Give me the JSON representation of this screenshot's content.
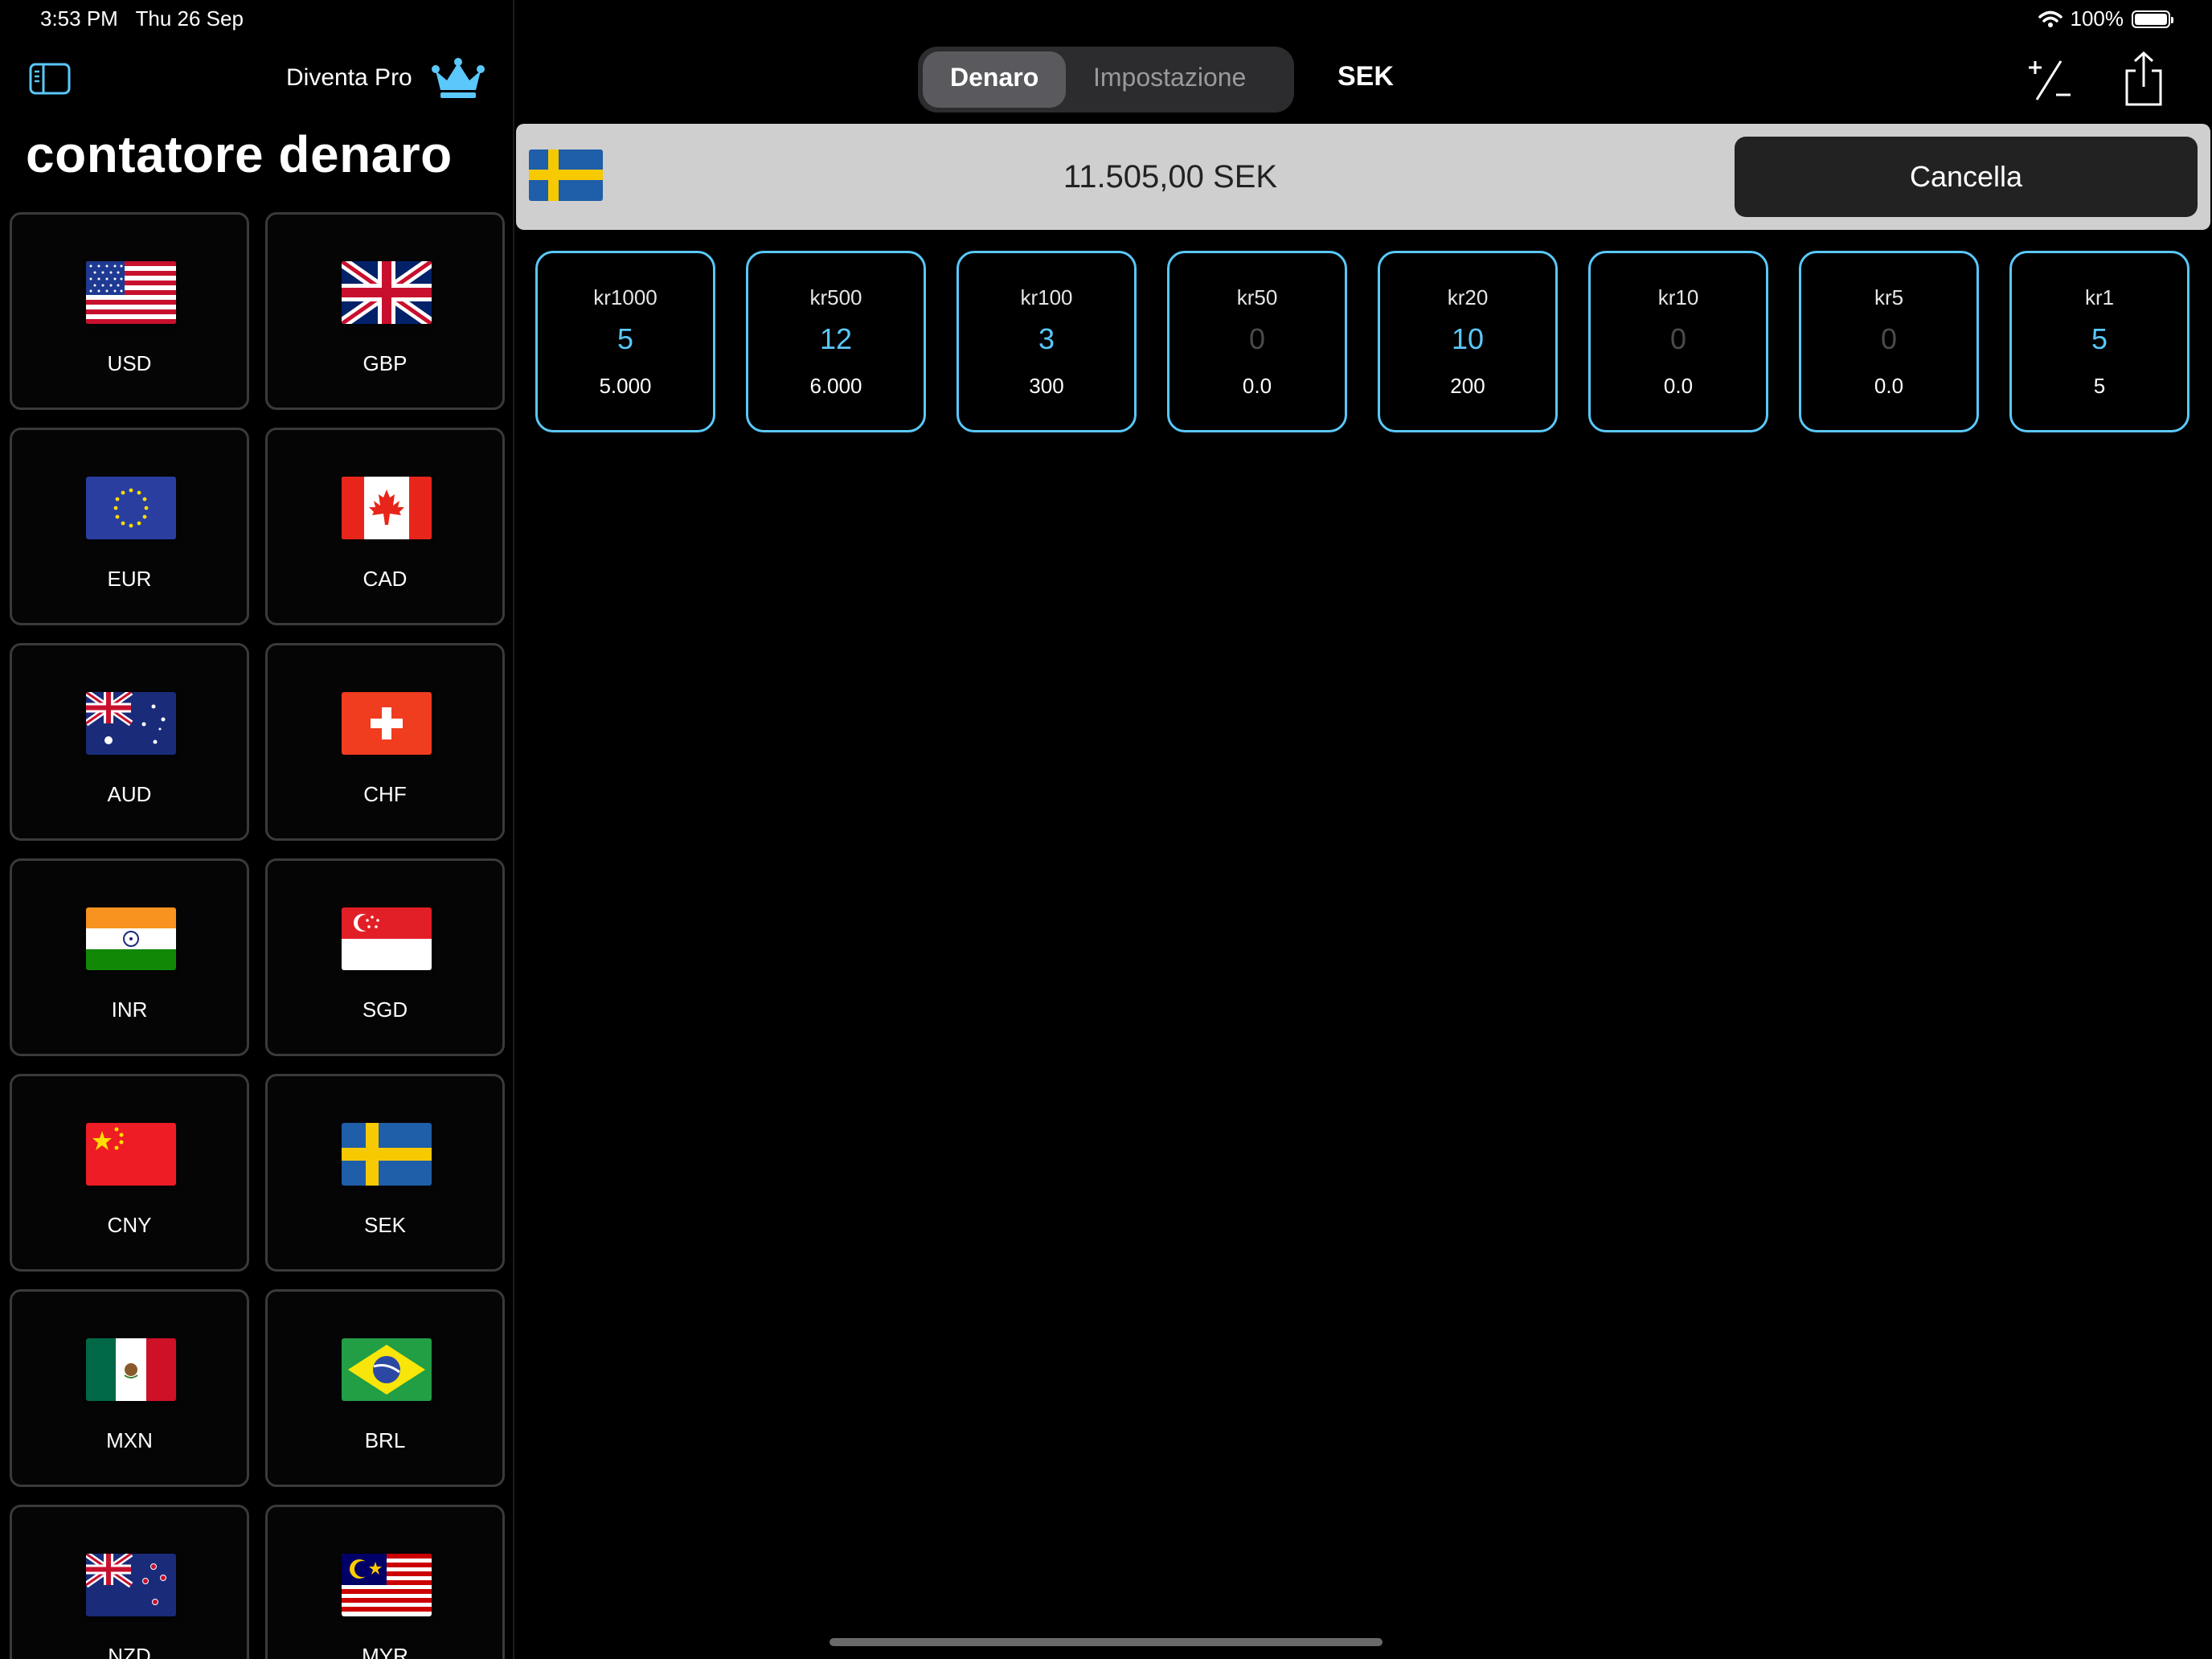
{
  "status": {
    "time": "3:53 PM",
    "date": "Thu 26 Sep",
    "battery": "100%"
  },
  "sidebar": {
    "pro_label": "Diventa Pro",
    "title": "contatore denaro",
    "currencies": [
      {
        "code": "USD",
        "flag": "us-flag"
      },
      {
        "code": "GBP",
        "flag": "gb-flag"
      },
      {
        "code": "EUR",
        "flag": "eu-flag"
      },
      {
        "code": "CAD",
        "flag": "ca-flag"
      },
      {
        "code": "AUD",
        "flag": "au-flag"
      },
      {
        "code": "CHF",
        "flag": "ch-flag"
      },
      {
        "code": "INR",
        "flag": "in-flag"
      },
      {
        "code": "SGD",
        "flag": "sg-flag"
      },
      {
        "code": "CNY",
        "flag": "cn-flag"
      },
      {
        "code": "SEK",
        "flag": "se-flag"
      },
      {
        "code": "MXN",
        "flag": "mx-flag"
      },
      {
        "code": "BRL",
        "flag": "br-flag"
      },
      {
        "code": "NZD",
        "flag": "nz-flag"
      },
      {
        "code": "MYR",
        "flag": "my-flag"
      }
    ]
  },
  "toolbar": {
    "tabs": [
      "Denaro",
      "Impostazione"
    ],
    "active_tab": "Denaro",
    "currency_code": "SEK"
  },
  "total": {
    "amount": "11.505,00 SEK",
    "clear_label": "Cancella"
  },
  "denominations": [
    {
      "label": "kr1000",
      "count": "5",
      "subtotal": "5.000"
    },
    {
      "label": "kr500",
      "count": "12",
      "subtotal": "6.000"
    },
    {
      "label": "kr100",
      "count": "3",
      "subtotal": "300"
    },
    {
      "label": "kr50",
      "count": "0",
      "subtotal": "0.0"
    },
    {
      "label": "kr20",
      "count": "10",
      "subtotal": "200"
    },
    {
      "label": "kr10",
      "count": "0",
      "subtotal": "0.0"
    },
    {
      "label": "kr5",
      "count": "0",
      "subtotal": "0.0"
    },
    {
      "label": "kr1",
      "count": "5",
      "subtotal": "5"
    }
  ],
  "colors": {
    "accent": "#5ac8fa",
    "bar": "#cfcfcf",
    "button": "#222222"
  }
}
